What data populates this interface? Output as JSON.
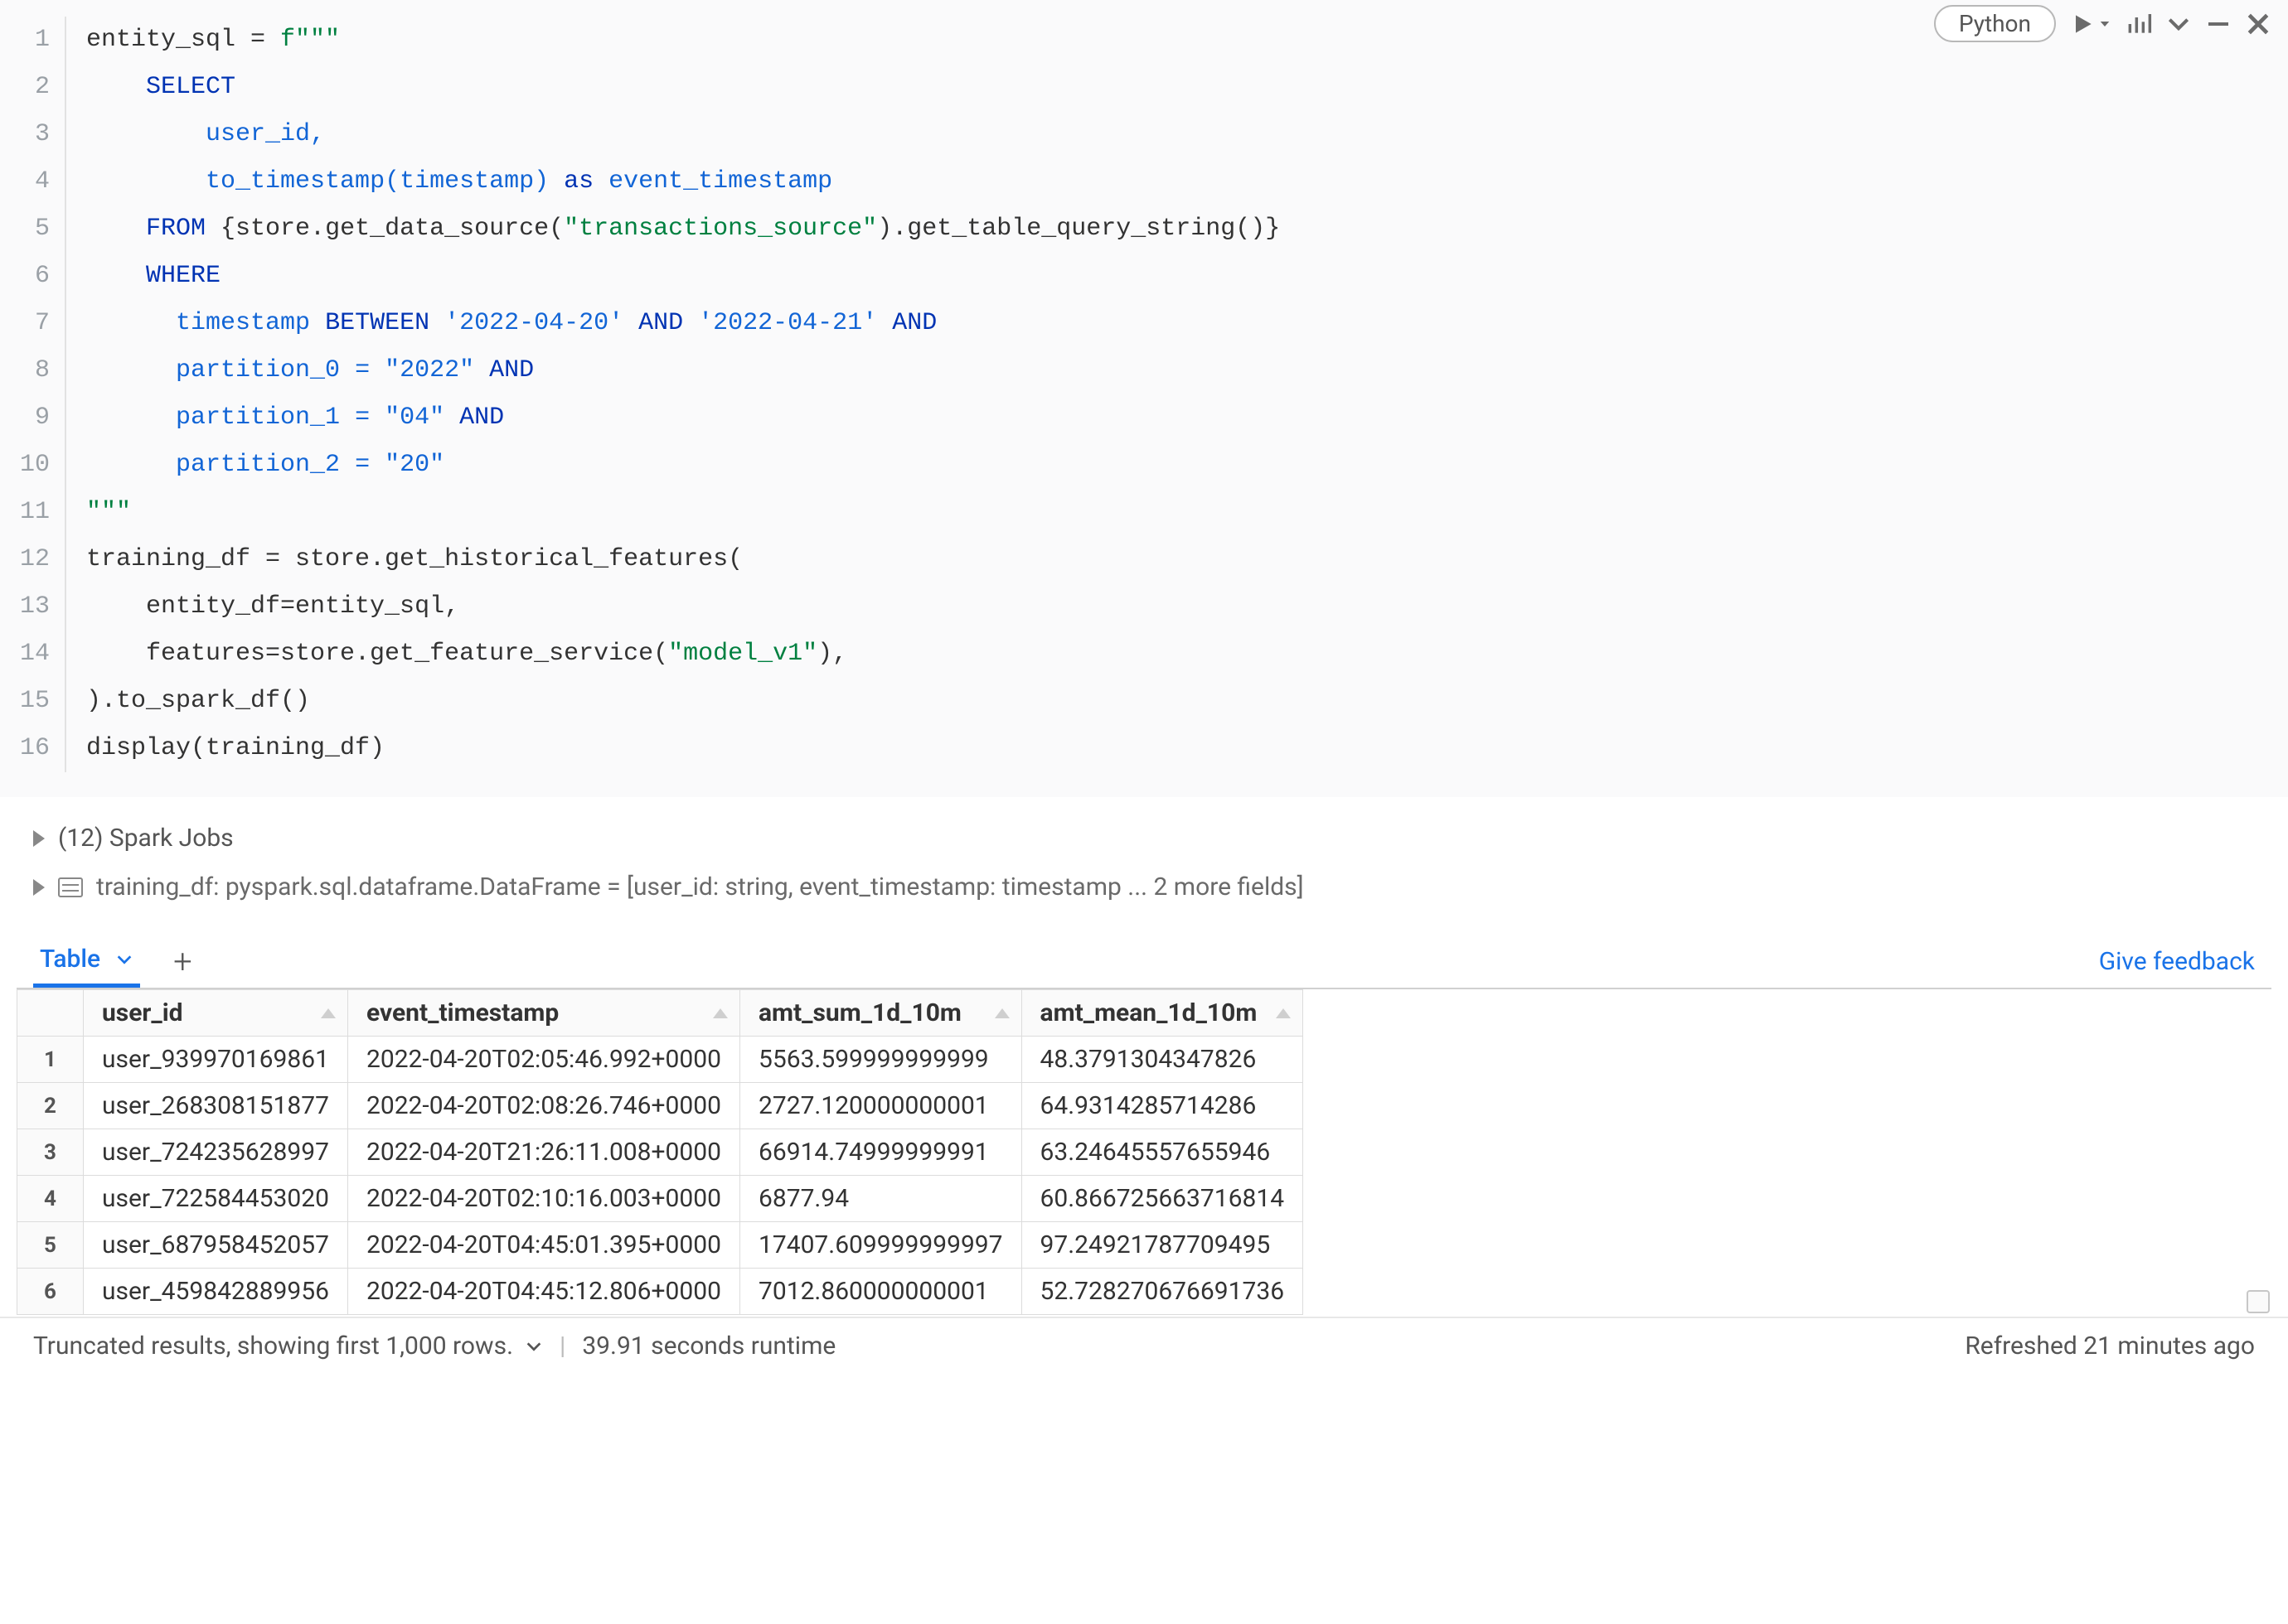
{
  "toolbar": {
    "language": "Python"
  },
  "code": {
    "line_count": 16,
    "tokens": [
      [
        {
          "t": "entity_sql = ",
          "c": "tok-def"
        },
        {
          "t": "f\"\"\"",
          "c": "tok-green"
        }
      ],
      [
        {
          "t": "    ",
          "c": ""
        },
        {
          "t": "SELECT",
          "c": "tok-kw"
        }
      ],
      [
        {
          "t": "        ",
          "c": ""
        },
        {
          "t": "user_id,",
          "c": "tok-fstr"
        }
      ],
      [
        {
          "t": "        ",
          "c": ""
        },
        {
          "t": "to_timestamp(timestamp) ",
          "c": "tok-fstr"
        },
        {
          "t": "as",
          "c": "tok-kw"
        },
        {
          "t": " event_timestamp",
          "c": "tok-fstr"
        }
      ],
      [
        {
          "t": "    ",
          "c": ""
        },
        {
          "t": "FROM",
          "c": "tok-kw"
        },
        {
          "t": " {",
          "c": "tok-def"
        },
        {
          "t": "store.get_data_source(",
          "c": "tok-def"
        },
        {
          "t": "\"transactions_source\"",
          "c": "tok-green"
        },
        {
          "t": ").get_table_query_string()}",
          "c": "tok-def"
        }
      ],
      [
        {
          "t": "    ",
          "c": ""
        },
        {
          "t": "WHERE",
          "c": "tok-kw"
        }
      ],
      [
        {
          "t": "      ",
          "c": ""
        },
        {
          "t": "timestamp ",
          "c": "tok-fstr"
        },
        {
          "t": "BETWEEN",
          "c": "tok-kw"
        },
        {
          "t": " '2022-04-20' ",
          "c": "tok-fstr"
        },
        {
          "t": "AND",
          "c": "tok-kw"
        },
        {
          "t": " '2022-04-21' ",
          "c": "tok-fstr"
        },
        {
          "t": "AND",
          "c": "tok-kw"
        }
      ],
      [
        {
          "t": "      ",
          "c": ""
        },
        {
          "t": "partition_0 = \"2022\" ",
          "c": "tok-fstr"
        },
        {
          "t": "AND",
          "c": "tok-kw"
        }
      ],
      [
        {
          "t": "      ",
          "c": ""
        },
        {
          "t": "partition_1 = \"04\" ",
          "c": "tok-fstr"
        },
        {
          "t": "AND",
          "c": "tok-kw"
        }
      ],
      [
        {
          "t": "      ",
          "c": ""
        },
        {
          "t": "partition_2 = \"20\"",
          "c": "tok-fstr"
        }
      ],
      [
        {
          "t": "\"\"\"",
          "c": "tok-green"
        }
      ],
      [
        {
          "t": "training_df = store.get_historical_features(",
          "c": "tok-def"
        }
      ],
      [
        {
          "t": "    entity_df=entity_sql,",
          "c": "tok-def"
        }
      ],
      [
        {
          "t": "    features=store.get_feature_service(",
          "c": "tok-def"
        },
        {
          "t": "\"model_v1\"",
          "c": "tok-green"
        },
        {
          "t": "),",
          "c": "tok-def"
        }
      ],
      [
        {
          "t": ").to_spark_df()",
          "c": "tok-def"
        }
      ],
      [
        {
          "t": "display(training_df)",
          "c": "tok-def"
        }
      ]
    ]
  },
  "outputs": {
    "spark_jobs": "(12) Spark Jobs",
    "schema_line": "training_df:  pyspark.sql.dataframe.DataFrame = [user_id: string, event_timestamp: timestamp ... 2 more fields]"
  },
  "tabs": {
    "active": "Table",
    "feedback": "Give feedback"
  },
  "table": {
    "columns": [
      "user_id",
      "event_timestamp",
      "amt_sum_1d_10m",
      "amt_mean_1d_10m"
    ],
    "rows": [
      [
        "user_939970169861",
        "2022-04-20T02:05:46.992+0000",
        "5563.599999999999",
        "48.3791304347826"
      ],
      [
        "user_268308151877",
        "2022-04-20T02:08:26.746+0000",
        "2727.120000000001",
        "64.9314285714286"
      ],
      [
        "user_724235628997",
        "2022-04-20T21:26:11.008+0000",
        "66914.74999999991",
        "63.24645557655946"
      ],
      [
        "user_722584453020",
        "2022-04-20T02:10:16.003+0000",
        "6877.94",
        "60.866725663716814"
      ],
      [
        "user_687958452057",
        "2022-04-20T04:45:01.395+0000",
        "17407.609999999997",
        "97.24921787709495"
      ],
      [
        "user_459842889956",
        "2022-04-20T04:45:12.806+0000",
        "7012.860000000001",
        "52.728270676691736"
      ]
    ]
  },
  "footer": {
    "truncated": "Truncated results, showing first 1,000 rows.",
    "runtime": "39.91 seconds runtime",
    "refreshed": "Refreshed 21 minutes ago"
  }
}
